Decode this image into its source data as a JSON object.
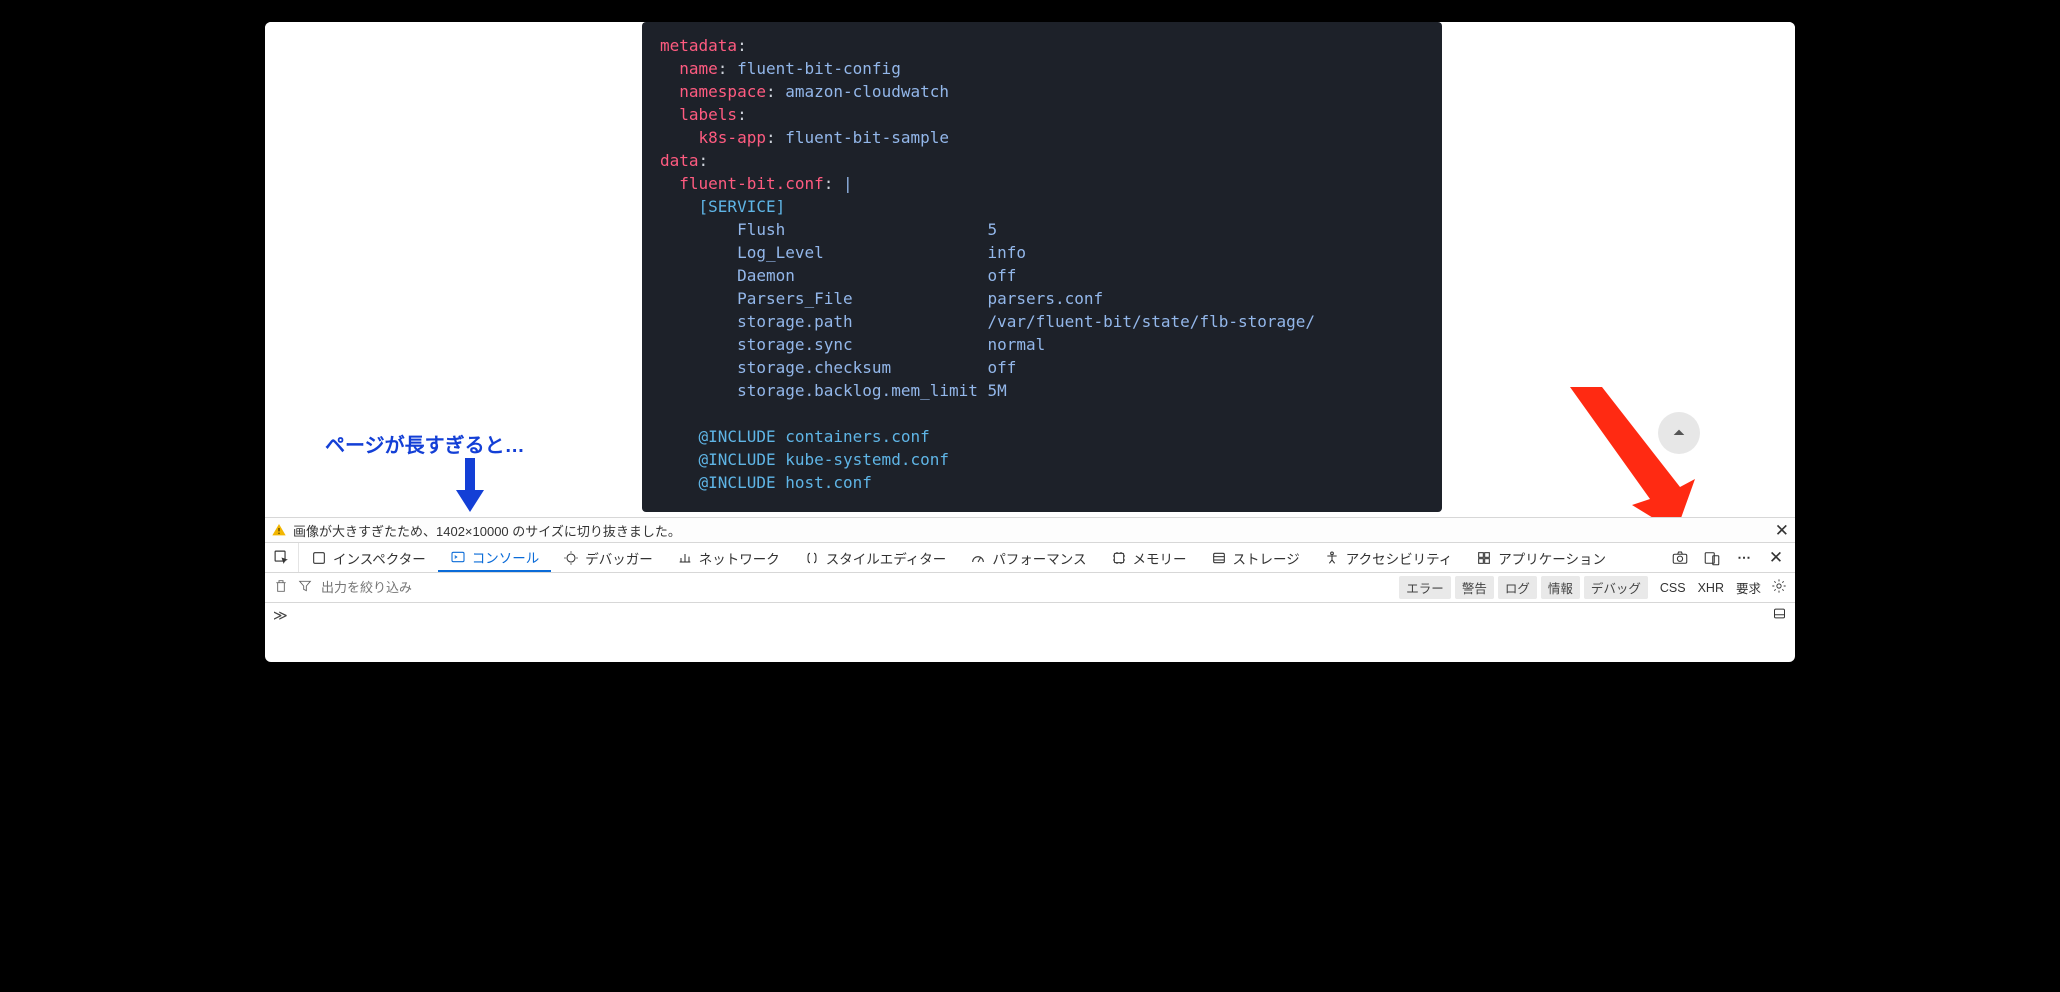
{
  "annotation": {
    "text": "ページが長すぎると…"
  },
  "code": {
    "lines": [
      {
        "indent": 0,
        "segs": [
          {
            "c": "tok-key",
            "t": "metadata"
          },
          {
            "c": "tok-plain",
            "t": ":"
          }
        ]
      },
      {
        "indent": 1,
        "segs": [
          {
            "c": "tok-key",
            "t": "name"
          },
          {
            "c": "tok-plain",
            "t": ": "
          },
          {
            "c": "tok-val",
            "t": "fluent-bit-config"
          }
        ]
      },
      {
        "indent": 1,
        "segs": [
          {
            "c": "tok-key",
            "t": "namespace"
          },
          {
            "c": "tok-plain",
            "t": ": "
          },
          {
            "c": "tok-val",
            "t": "amazon-cloudwatch"
          }
        ]
      },
      {
        "indent": 1,
        "segs": [
          {
            "c": "tok-key",
            "t": "labels"
          },
          {
            "c": "tok-plain",
            "t": ":"
          }
        ]
      },
      {
        "indent": 2,
        "segs": [
          {
            "c": "tok-key",
            "t": "k8s-app"
          },
          {
            "c": "tok-plain",
            "t": ": "
          },
          {
            "c": "tok-val",
            "t": "fluent-bit-sample"
          }
        ]
      },
      {
        "indent": 0,
        "segs": [
          {
            "c": "tok-key",
            "t": "data"
          },
          {
            "c": "tok-plain",
            "t": ":"
          }
        ]
      },
      {
        "indent": 1,
        "segs": [
          {
            "c": "tok-key",
            "t": "fluent-bit.conf"
          },
          {
            "c": "tok-plain",
            "t": ": "
          },
          {
            "c": "tok-val",
            "t": "|"
          }
        ]
      },
      {
        "indent": 2,
        "segs": [
          {
            "c": "tok-brkt",
            "t": "[SERVICE]"
          }
        ]
      },
      {
        "indent": 0,
        "raw": "        Flush                     5",
        "segs": [
          {
            "c": "tok-val",
            "t": "Flush                     5"
          }
        ]
      },
      {
        "indent": 0,
        "raw": "        Log_Level                 info",
        "segs": [
          {
            "c": "tok-val",
            "t": "Log_Level                 info"
          }
        ]
      },
      {
        "indent": 0,
        "raw": "        Daemon                    off",
        "segs": [
          {
            "c": "tok-val",
            "t": "Daemon                    off"
          }
        ]
      },
      {
        "indent": 0,
        "raw": "        Parsers_File              parsers.conf",
        "segs": [
          {
            "c": "tok-val",
            "t": "Parsers_File              parsers.conf"
          }
        ]
      },
      {
        "indent": 0,
        "raw": "        storage.path              /var/fluent-bit/state/flb-storage/",
        "segs": [
          {
            "c": "tok-val",
            "t": "storage.path              /var/fluent-bit/state/flb-storage/"
          }
        ]
      },
      {
        "indent": 0,
        "raw": "        storage.sync              normal",
        "segs": [
          {
            "c": "tok-val",
            "t": "storage.sync              normal"
          }
        ]
      },
      {
        "indent": 0,
        "raw": "        storage.checksum          off",
        "segs": [
          {
            "c": "tok-val",
            "t": "storage.checksum          off"
          }
        ]
      },
      {
        "indent": 0,
        "raw": "        storage.backlog.mem_limit 5M",
        "segs": [
          {
            "c": "tok-val",
            "t": "storage.backlog.mem_limit 5M"
          }
        ]
      },
      {
        "indent": 0,
        "segs": [
          {
            "c": "tok-plain",
            "t": " "
          }
        ]
      },
      {
        "indent": 2,
        "segs": [
          {
            "c": "tok-inc",
            "t": "@INCLUDE containers.conf"
          }
        ]
      },
      {
        "indent": 2,
        "segs": [
          {
            "c": "tok-inc",
            "t": "@INCLUDE kube-systemd.conf"
          }
        ]
      },
      {
        "indent": 2,
        "segs": [
          {
            "c": "tok-inc",
            "t": "@INCLUDE host.conf"
          }
        ]
      }
    ]
  },
  "warning": {
    "text": "画像が大きすぎたため、1402×10000 のサイズに切り抜きました。"
  },
  "devtools": {
    "tabs": [
      {
        "id": "inspector",
        "label": "インスペクター",
        "icon": "box"
      },
      {
        "id": "console",
        "label": "コンソール",
        "icon": "console",
        "active": true
      },
      {
        "id": "debugger",
        "label": "デバッガー",
        "icon": "debug"
      },
      {
        "id": "network",
        "label": "ネットワーク",
        "icon": "network"
      },
      {
        "id": "style",
        "label": "スタイルエディター",
        "icon": "braces"
      },
      {
        "id": "perf",
        "label": "パフォーマンス",
        "icon": "perf"
      },
      {
        "id": "memory",
        "label": "メモリー",
        "icon": "memory"
      },
      {
        "id": "storage",
        "label": "ストレージ",
        "icon": "storage"
      },
      {
        "id": "a11y",
        "label": "アクセシビリティ",
        "icon": "a11y"
      },
      {
        "id": "app",
        "label": "アプリケーション",
        "icon": "app"
      }
    ]
  },
  "console_filter": {
    "placeholder": "出力を絞り込み",
    "pills": [
      "エラー",
      "警告",
      "ログ",
      "情報",
      "デバッグ"
    ],
    "texts": [
      "CSS",
      "XHR",
      "要求"
    ]
  }
}
